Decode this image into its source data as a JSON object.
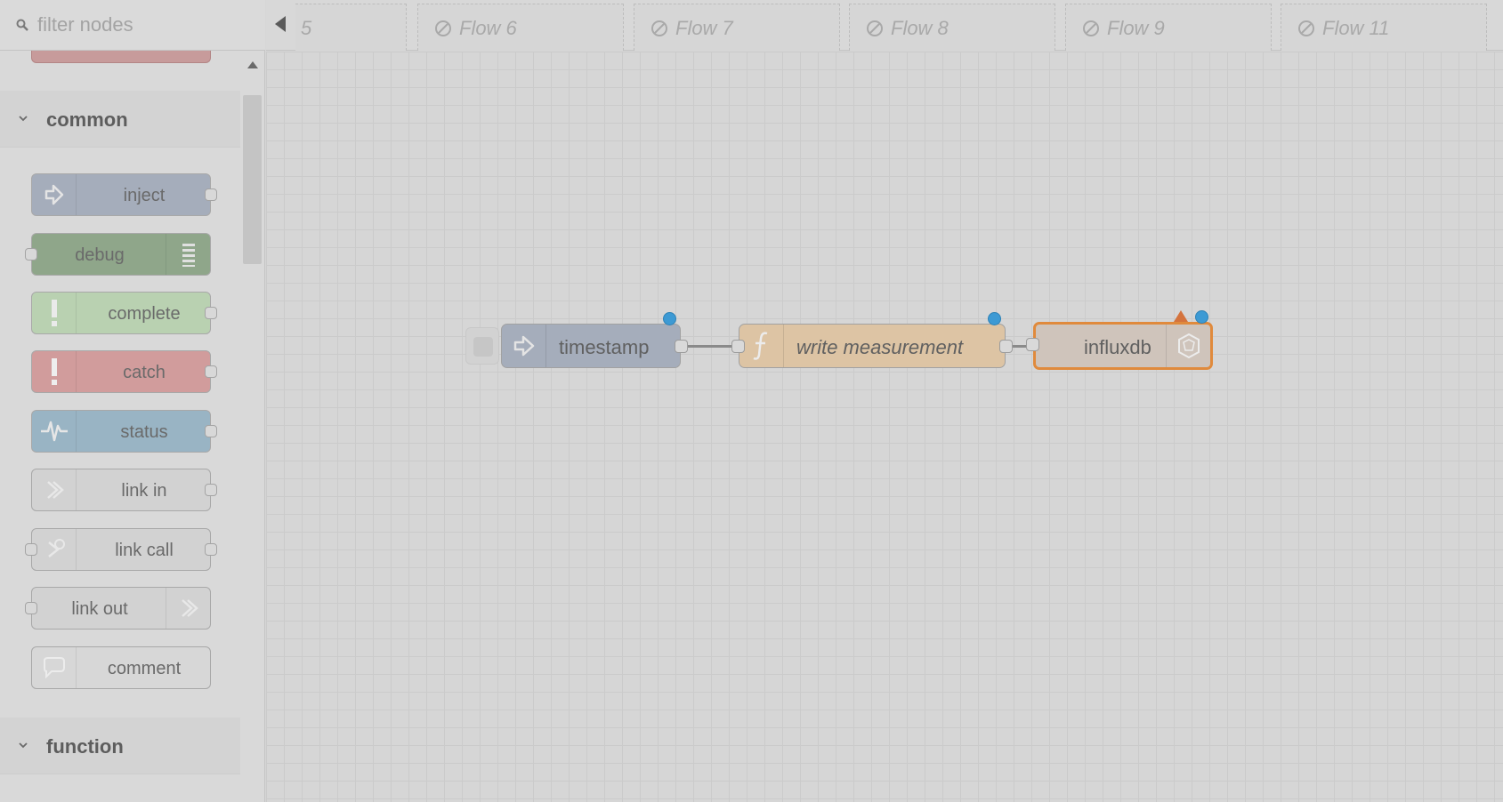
{
  "palette": {
    "filter": {
      "placeholder": "filter nodes"
    },
    "categories": [
      {
        "label": "common",
        "nodes": [
          {
            "label": "inject",
            "icon": "arrow-in-icon",
            "color": "#a5adbb"
          },
          {
            "label": "debug",
            "icon": "list-icon",
            "color": "#8fa68a"
          },
          {
            "label": "complete",
            "icon": "exclamation-icon",
            "color": "#b9d1b1"
          },
          {
            "label": "catch",
            "icon": "exclamation-icon",
            "color": "#d19c9c"
          },
          {
            "label": "status",
            "icon": "pulse-icon",
            "color": "#99b4c4"
          },
          {
            "label": "link in",
            "icon": "link-in-icon",
            "color": "#d2d2d2"
          },
          {
            "label": "link call",
            "icon": "link-call-icon",
            "color": "#d2d2d2"
          },
          {
            "label": "link out",
            "icon": "link-out-icon",
            "color": "#d2d2d2"
          },
          {
            "label": "comment",
            "icon": "comment-icon",
            "color": "#d7d7d7"
          }
        ]
      },
      {
        "label": "function",
        "nodes": []
      }
    ]
  },
  "tabs": [
    {
      "label": "5",
      "disabled": true
    },
    {
      "label": "Flow 6",
      "disabled": true
    },
    {
      "label": "Flow 7",
      "disabled": true
    },
    {
      "label": "Flow 8",
      "disabled": true
    },
    {
      "label": "Flow 9",
      "disabled": true
    },
    {
      "label": "Flow 11",
      "disabled": true
    }
  ],
  "flow": {
    "nodes": [
      {
        "label": "timestamp",
        "type": "inject",
        "color": "#a5adbb",
        "changed": true
      },
      {
        "label": "write measurement",
        "type": "function",
        "color": "#ddc4a4",
        "changed": true
      },
      {
        "label": "influxdb",
        "type": "influxdb out",
        "color": "#cfc4bb",
        "changed": true,
        "selected": true,
        "selection_color": "#e08a3c",
        "warning": true
      }
    ]
  }
}
